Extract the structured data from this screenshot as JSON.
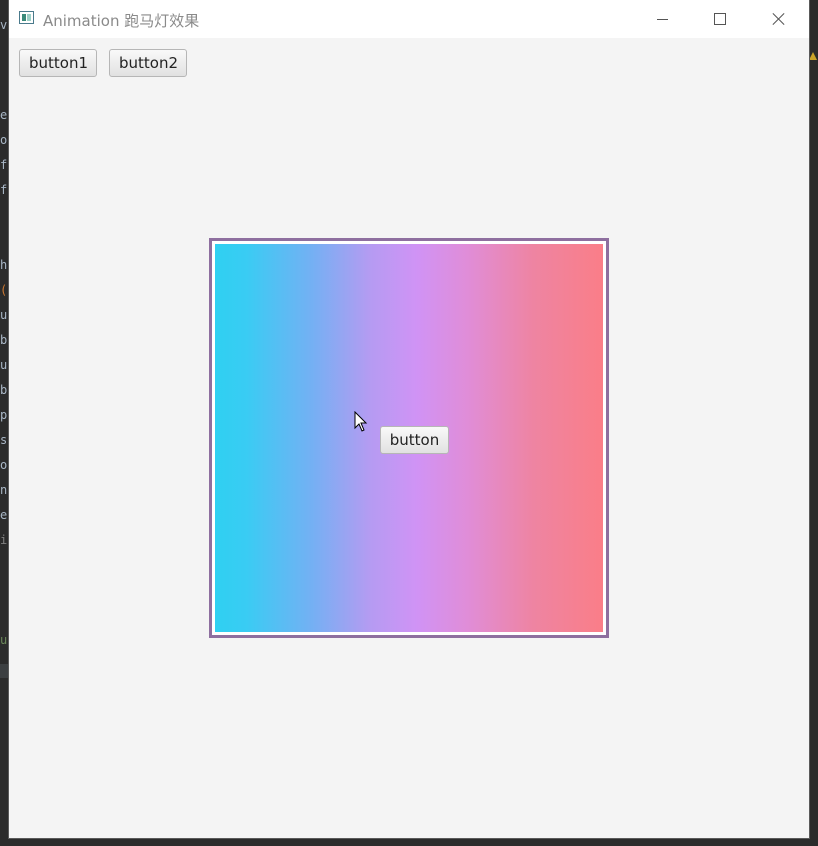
{
  "window": {
    "title": "Animation 跑马灯效果",
    "app_icon": "app-window-icon",
    "controls": [
      "minimize-icon",
      "maximize-icon",
      "close-icon"
    ]
  },
  "toolbar": {
    "button1_label": "button1",
    "button2_label": "button2"
  },
  "stage": {
    "border_color": "#8e6f9f",
    "gradient_colors": [
      "#2fd0f2",
      "#74b0f3",
      "#d093f5",
      "#ee84a2",
      "#fa7e88"
    ],
    "center_button_label": "button"
  },
  "background_ide": {
    "edge_chars": [
      "v",
      "e",
      "o",
      "f",
      "f",
      "h",
      "(",
      "u",
      "b",
      "u",
      "b",
      "p",
      "s",
      "o",
      "n",
      "e",
      "i",
      "u"
    ]
  }
}
